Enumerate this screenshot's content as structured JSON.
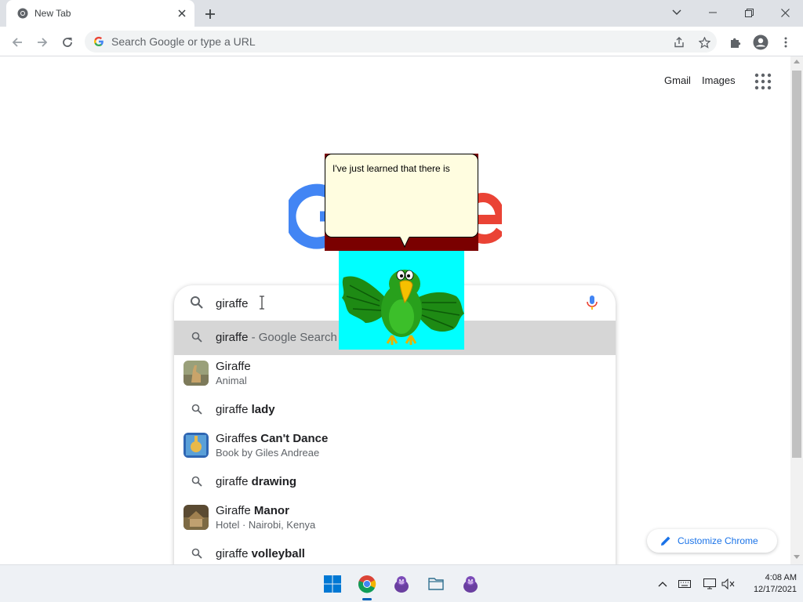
{
  "browser": {
    "tab_title": "New Tab",
    "omnibox_placeholder": "Search Google or type a URL"
  },
  "page": {
    "top_links": [
      "Gmail",
      "Images"
    ],
    "search_value": "giraffe",
    "customize_label": "Customize Chrome"
  },
  "suggestions": [
    {
      "main": "giraffe",
      "bold": "",
      "suffix": " - Google Search",
      "sub": "",
      "kind": "search",
      "highlighted": true
    },
    {
      "main": "Giraffe",
      "bold": "",
      "suffix": "",
      "sub": "Animal",
      "kind": "entity"
    },
    {
      "main": "giraffe ",
      "bold": "lady",
      "suffix": "",
      "sub": "",
      "kind": "search"
    },
    {
      "main": "Giraffe",
      "bold": "s Can't Dance",
      "suffix": "",
      "sub": "Book by Giles Andreae",
      "kind": "entity"
    },
    {
      "main": "giraffe ",
      "bold": "drawing",
      "suffix": "",
      "sub": "",
      "kind": "search"
    },
    {
      "main": "Giraffe ",
      "bold": "Manor",
      "suffix": "",
      "sub": "Hotel · Nairobi, Kenya",
      "kind": "entity"
    },
    {
      "main": "giraffe ",
      "bold": "volleyball",
      "suffix": "",
      "sub": "",
      "kind": "search"
    }
  ],
  "assistant": {
    "speech": "I've just learned that there is"
  },
  "taskbar": {
    "time": "4:08 AM",
    "date": "12/17/2021"
  },
  "colors": {
    "accent": "#1a73e8",
    "highlight": "#d6d6d6",
    "bubble": "#fffde0",
    "parrot_bg": "#00ffff"
  }
}
